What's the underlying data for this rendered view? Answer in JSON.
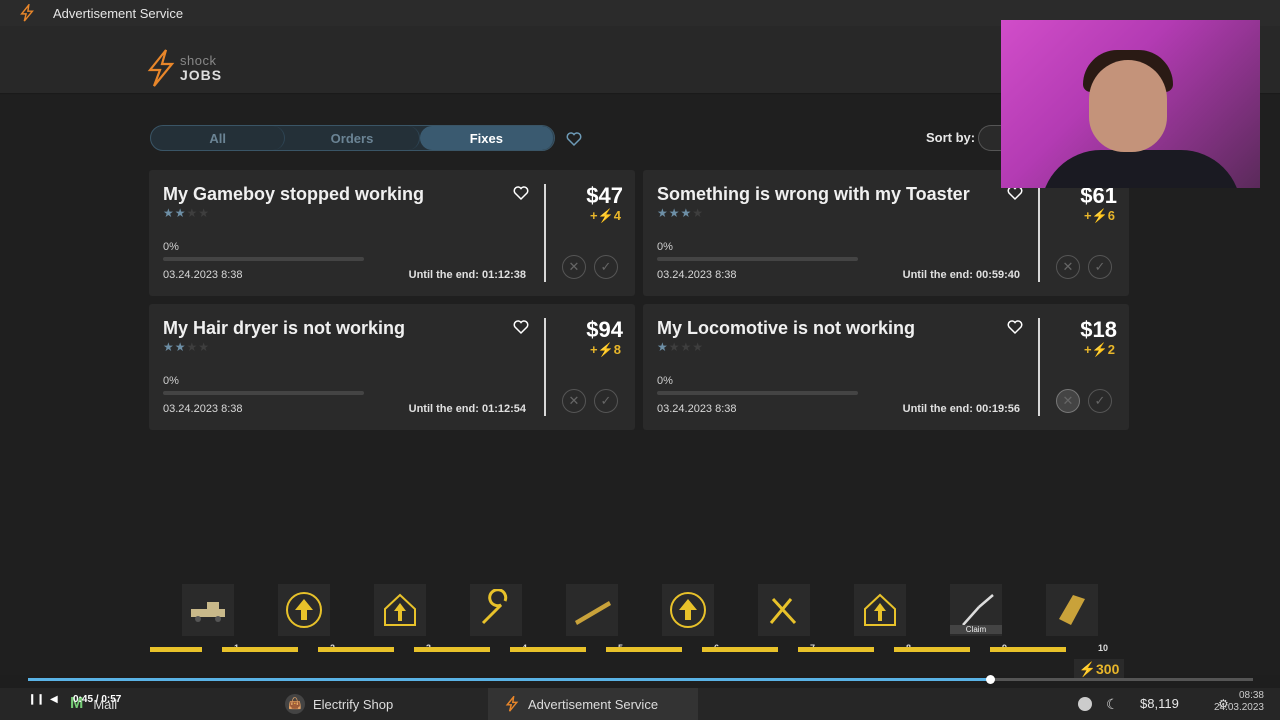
{
  "window": {
    "title": "Advertisement Service"
  },
  "logo": {
    "line1": "shock",
    "line2": "JOBS"
  },
  "tabs": [
    {
      "label": "All",
      "active": false
    },
    {
      "label": "Orders",
      "active": false
    },
    {
      "label": "Fixes",
      "active": true
    }
  ],
  "sort": {
    "label": "Sort by:"
  },
  "jobs": [
    {
      "title": "My Gameboy stopped working",
      "stars": 2,
      "max_stars": 4,
      "progress_label": "0%",
      "progress": 0,
      "date": "03.24.2023 8:38",
      "until": "Until the end: 01:12:38",
      "price": "$47",
      "bonus": "+⚡4"
    },
    {
      "title": "Something is wrong with my Toaster",
      "stars": 3,
      "max_stars": 4,
      "progress_label": "0%",
      "progress": 0,
      "date": "03.24.2023 8:38",
      "until": "Until the end: 00:59:40",
      "price": "$61",
      "bonus": "+⚡6"
    },
    {
      "title": "My Hair dryer is not working",
      "stars": 2,
      "max_stars": 4,
      "progress_label": "0%",
      "progress": 0,
      "date": "03.24.2023 8:38",
      "until": "Until the end: 01:12:54",
      "price": "$94",
      "bonus": "+⚡8"
    },
    {
      "title": "My Locomotive is not working",
      "stars": 1,
      "max_stars": 4,
      "progress_label": "0%",
      "progress": 0,
      "date": "03.24.2023 8:38",
      "until": "Until the end: 00:19:56",
      "price": "$18",
      "bonus": "+⚡2"
    }
  ],
  "levels": {
    "numbers": [
      "1",
      "2",
      "3",
      "4",
      "5",
      "6",
      "7",
      "8",
      "9",
      "10"
    ],
    "rewards": [
      "pickup-truck-icon",
      "upgrade-arrow-icon",
      "house-upgrade-icon",
      "wrench-icon",
      "plank-icon",
      "upgrade-arrow-icon",
      "double-wrench-icon",
      "house-upgrade-icon",
      "soldering-iron-icon",
      "gold-bar-icon"
    ],
    "claim_label": "Claim",
    "level_reward": "⚡300"
  },
  "taskbar": {
    "mail": "Mail",
    "shop": "Electrify Shop",
    "ads": "Advertisement Service",
    "money": "$8,119",
    "time": "08:38",
    "date": "24.03.2023"
  },
  "video": {
    "time": "0:45 / 0:57",
    "progress": 0.785
  },
  "colors": {
    "accent": "#e8b62a",
    "tab_active": "#3a5a70",
    "star": "#6d8fa6",
    "logo_orange": "#e8862a"
  }
}
